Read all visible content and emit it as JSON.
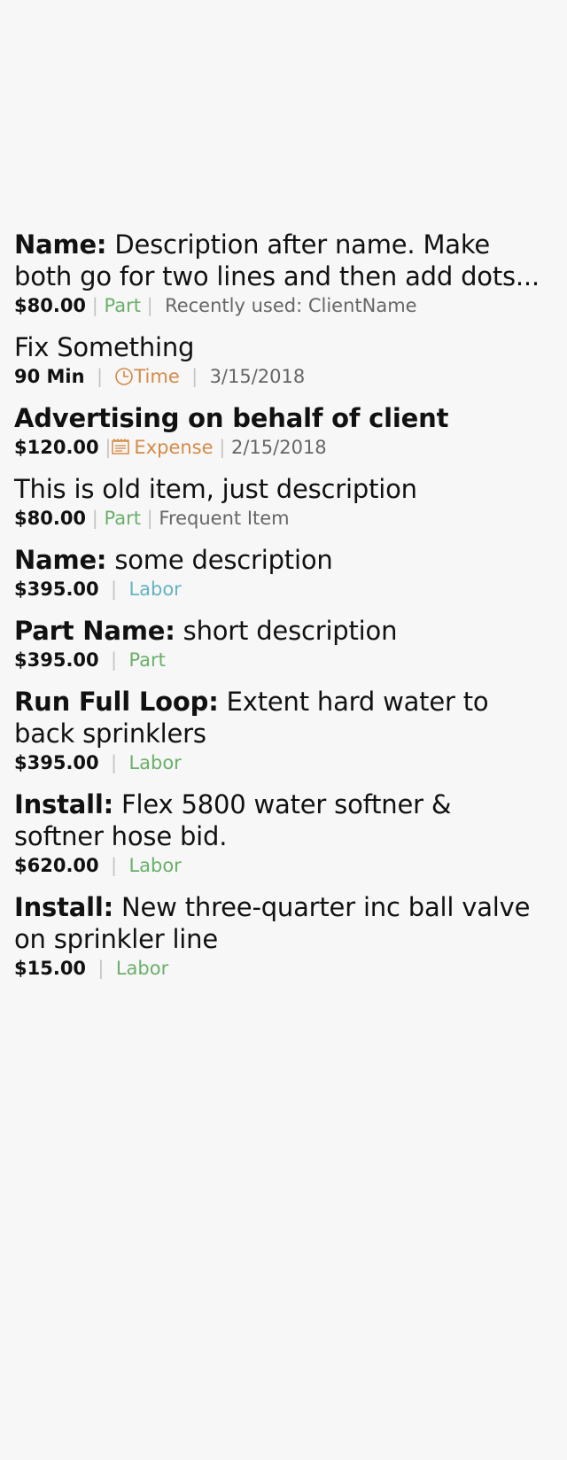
{
  "items": [
    {
      "name": "Name:",
      "description": "Description after name. Make both go for two lines and then add dots...",
      "price": "$80.00",
      "type": "Part",
      "extra": "Recently used: ClientName"
    },
    {
      "description": "Fix Something",
      "price": "90 Min",
      "type": "Time",
      "date": "3/15/2018",
      "icon": "clock-icon"
    },
    {
      "description": "Advertising on behalf of client",
      "price": "$120.00",
      "type": "Expense",
      "date": "2/15/2018",
      "icon": "receipt-icon"
    },
    {
      "description": "This is old item, just description",
      "price": "$80.00",
      "type": "Part",
      "extra": "Frequent Item"
    },
    {
      "name": "Name:",
      "description": "some description",
      "price": "$395.00",
      "type": "Labor"
    },
    {
      "name": "Part Name:",
      "description": "short description",
      "price": "$395.00",
      "type": "Part"
    },
    {
      "name": "Run Full Loop:",
      "description": "Extent hard water to back sprinklers",
      "price": "$395.00",
      "type": "Labor"
    },
    {
      "name": "Install:",
      "description": "Flex 5800 water softner & softner hose bid.",
      "price": "$620.00",
      "type": "Labor"
    },
    {
      "name": "Install:",
      "description": "New three-quarter inc ball valve on sprinkler line",
      "price": "$15.00",
      "type": "Labor"
    }
  ],
  "colors": {
    "part": "#6ab06a",
    "labor_teal": "#64b3c2",
    "labor_green": "#6ab06a",
    "time_expense": "#d48a47",
    "separator": "#c4c4c4",
    "muted_text": "#666666",
    "background": "#f7f7f7"
  }
}
